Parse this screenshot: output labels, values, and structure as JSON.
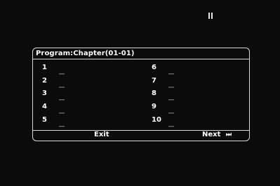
{
  "status": {
    "playback_icon": "pause-icon"
  },
  "program": {
    "title": "Program:Chapter(01-01)",
    "left_column": [
      {
        "num": "1",
        "value": "__"
      },
      {
        "num": "2",
        "value": "__"
      },
      {
        "num": "3",
        "value": "__"
      },
      {
        "num": "4",
        "value": "__"
      },
      {
        "num": "5",
        "value": "__"
      }
    ],
    "right_column": [
      {
        "num": "6",
        "value": "__"
      },
      {
        "num": "7",
        "value": "__"
      },
      {
        "num": "8",
        "value": "__"
      },
      {
        "num": "9",
        "value": "__"
      },
      {
        "num": "10",
        "value": "__"
      }
    ],
    "exit_label": "Exit",
    "next_label": "Next",
    "next_icon": "⏭"
  }
}
